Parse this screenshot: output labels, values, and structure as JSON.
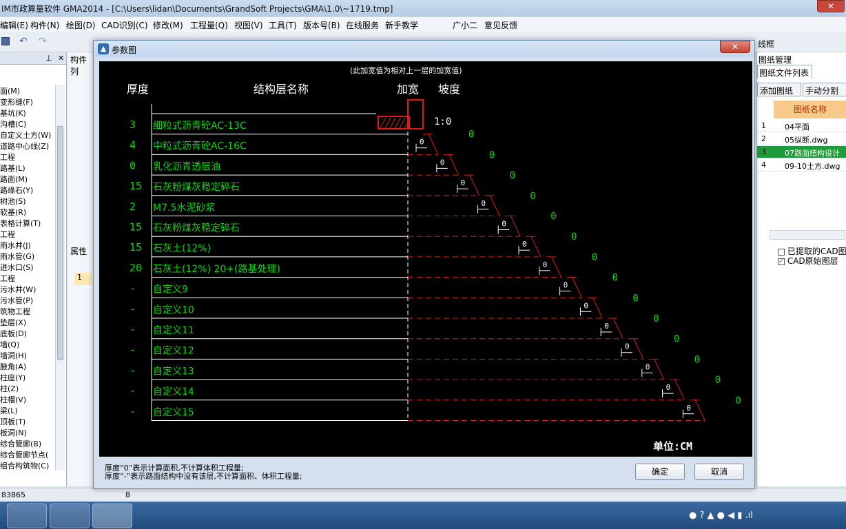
{
  "app": {
    "title": "IM市政算量软件 GMA2014 - [C:\\Users\\lidan\\Documents\\GrandSoft Projects\\GMA\\1.0\\~1719.tmp]",
    "close_glyph": "✕"
  },
  "menu": [
    "编辑(E)",
    "构件(N)",
    "绘图(D)",
    "CAD识别(C)",
    "修改(M)",
    "工程量(Q)",
    "视图(V)",
    "工具(T)",
    "版本号(B)",
    "在线服务",
    "新手教学",
    "广小二",
    "意见反馈"
  ],
  "left_panel": {
    "header": [
      "构件列",
      "构件"
    ],
    "items": [
      "面(M)",
      "变形缝(F)",
      "基坑(K)",
      "沟槽(C)",
      "自定义土方(W)",
      "道路中心线(Z)",
      "工程",
      "路基(L)",
      "路面(M)",
      "路缘石(Y)",
      "树池(S)",
      "软基(R)",
      "表格计算(T)",
      "工程",
      "雨水井(J)",
      "雨水管(G)",
      "进水口(S)",
      "工程",
      "污水井(W)",
      "污水管(P)",
      "筑物工程",
      "垫层(X)",
      "底板(D)",
      "墙(Q)",
      "墙洞(H)",
      "腋角(A)",
      "柱座(Y)",
      "柱(Z)",
      "柱帽(V)",
      "梁(L)",
      "顶板(T)",
      "板洞(N)",
      "综合管廊(B)",
      "综合管廊节点(",
      "组合构筑物(C)"
    ]
  },
  "mid_panel": {
    "prop_label": "属性",
    "row_no": "1"
  },
  "right_panel": {
    "title": "图纸管理",
    "tab": "图纸文件列表",
    "btn_add": "添加图纸",
    "btn_split": "手动分割",
    "col_header": "图纸名称",
    "rows": [
      {
        "no": "1",
        "name": "04平面"
      },
      {
        "no": "2",
        "name": "05纵断.dwg"
      },
      {
        "no": "3",
        "name": "07路面结构设计"
      },
      {
        "no": "4",
        "name": "09-10土方.dwg"
      }
    ],
    "layers": [
      "已提取的CAD图层",
      "CAD原始图层"
    ],
    "toolbar_hint": "线框"
  },
  "status": {
    "coord": "83865",
    "val": "8"
  },
  "dialog": {
    "title": "参数图",
    "note_top": "(此加宽值为相对上一层的加宽值)",
    "col_thickness": "厚度",
    "col_name": "结构层名称",
    "col_widen": "加宽",
    "col_slope": "坡度",
    "first_slope": "1:0",
    "unit": "单位:CM",
    "layers": [
      {
        "t": "3",
        "name": "细粒式沥青砼AC-13C",
        "w": "0",
        "s": "1:0"
      },
      {
        "t": "4",
        "name": "中粒式沥青砼AC-16C",
        "w": "0",
        "s": "0"
      },
      {
        "t": "0",
        "name": "乳化沥青透层油",
        "w": "0",
        "s": "0"
      },
      {
        "t": "15",
        "name": "石灰粉煤灰稳定碎石",
        "w": "0",
        "s": "0"
      },
      {
        "t": "2",
        "name": "M7.5水泥砂浆",
        "w": "0",
        "s": "0"
      },
      {
        "t": "15",
        "name": "石灰粉煤灰稳定碎石",
        "w": "0",
        "s": "0"
      },
      {
        "t": "15",
        "name": "石灰土(12%)",
        "w": "0",
        "s": "0"
      },
      {
        "t": "20",
        "name": "石灰土(12%) 20+(路基处理)",
        "w": "0",
        "s": "0"
      },
      {
        "t": "-",
        "name": "自定义9",
        "w": "0",
        "s": "0"
      },
      {
        "t": "-",
        "name": "自定义10",
        "w": "0",
        "s": "0"
      },
      {
        "t": "-",
        "name": "自定义11",
        "w": "0",
        "s": "0"
      },
      {
        "t": "-",
        "name": "自定义12",
        "w": "0",
        "s": "0"
      },
      {
        "t": "-",
        "name": "自定义13",
        "w": "0",
        "s": "0"
      },
      {
        "t": "-",
        "name": "自定义14",
        "w": "0",
        "s": "0"
      },
      {
        "t": "-",
        "name": "自定义15",
        "w": "0",
        "s": "0"
      }
    ],
    "note1": "厚度“0”表示计算面积,不计算体积工程量;",
    "note2": "厚度“-”表示路面结构中没有该层,不计算面积、体积工程量;",
    "btn_ok": "确定",
    "btn_cancel": "取消",
    "colors": {
      "green": "#00dd00",
      "red": "#e01818",
      "white": "#ffffff",
      "black": "#000000"
    }
  }
}
